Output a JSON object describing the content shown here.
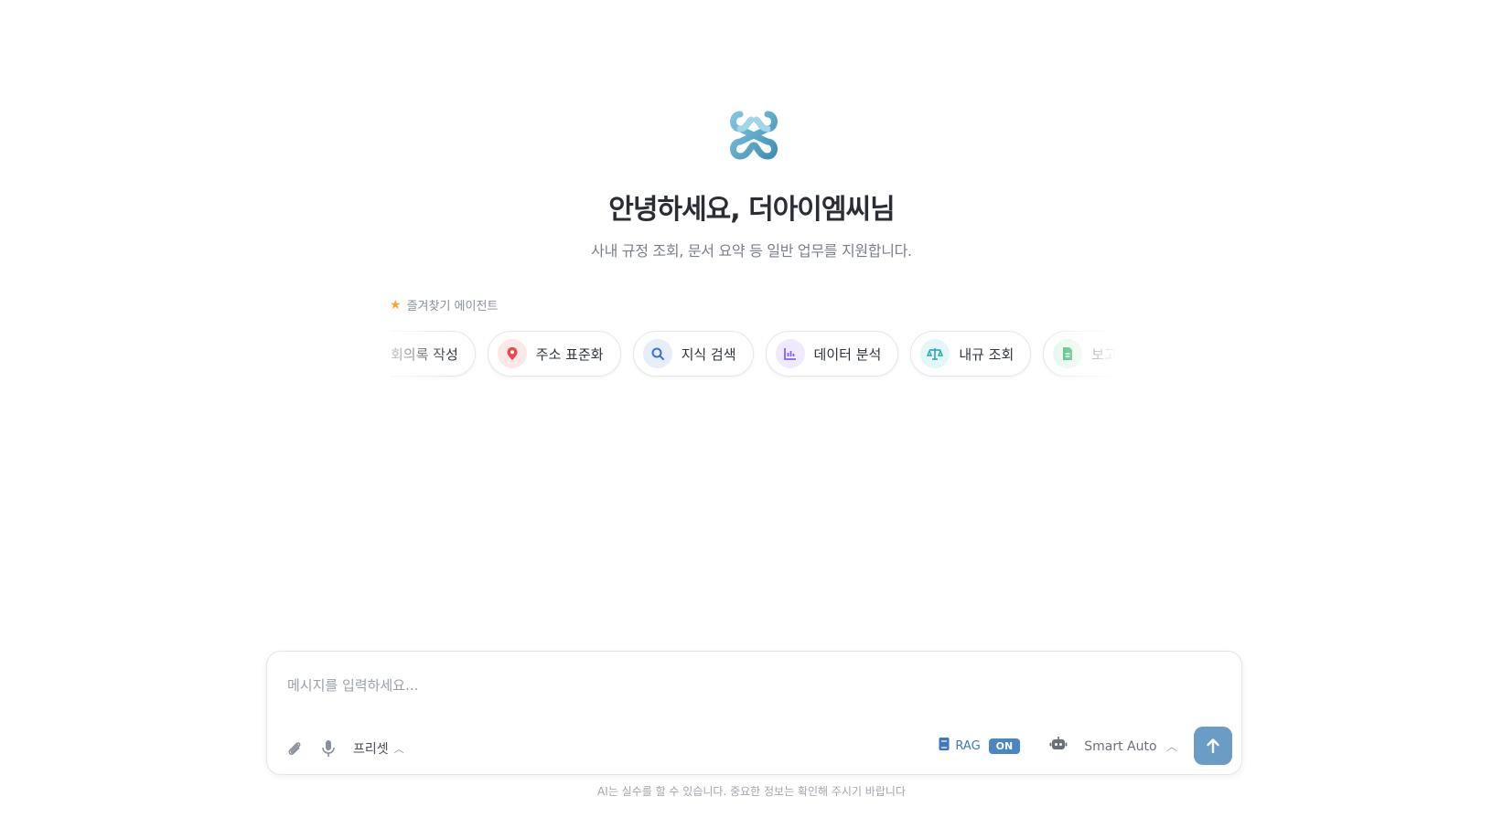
{
  "header": {
    "greeting": "안녕하세요, 더아이엠씨님",
    "subtitle": "사내 규정 조회, 문서 요약 등 일반 업무를 지원합니다."
  },
  "favorites": {
    "label": "즐겨찾기 에이전트",
    "chips": [
      {
        "label": "회의록 작성",
        "icon": "none"
      },
      {
        "label": "주소 표준화",
        "icon": "map-pin-icon",
        "color": "#e5484d",
        "bg": "#fde8e8"
      },
      {
        "label": "지식 검색",
        "icon": "search-icon",
        "color": "#3b6fd8",
        "bg": "#e6eefc"
      },
      {
        "label": "데이터 분석",
        "icon": "chart-icon",
        "color": "#8b5cf6",
        "bg": "#f0eafe"
      },
      {
        "label": "내규 조회",
        "icon": "scale-icon",
        "color": "#2aa7b8",
        "bg": "#e3f6f8"
      },
      {
        "label": "보고서",
        "icon": "document-icon",
        "color": "#2fb36b",
        "bg": "#e4f7ec"
      }
    ]
  },
  "composer": {
    "placeholder": "메시지를 입력하세요...",
    "preset_label": "프리셋",
    "rag_label": "RAG",
    "rag_state": "ON",
    "model_label": "Smart Auto"
  },
  "footer": {
    "disclaimer": "AI는 실수를 할 수 있습니다. 중요한 정보는 확인해 주시기 바랍니다"
  },
  "colors": {
    "accent": "#6a9cc6",
    "rag": "#4a86c3",
    "star": "#f5a623"
  }
}
